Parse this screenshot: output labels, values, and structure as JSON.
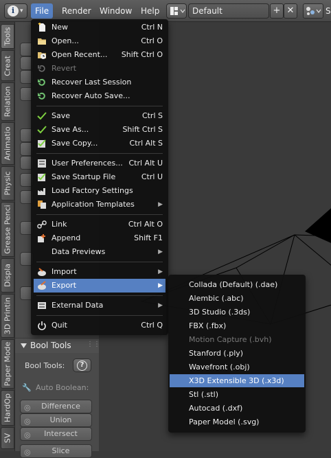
{
  "topbar": {
    "info_icon": "info-icon",
    "menus": [
      "File",
      "Render",
      "Window",
      "Help"
    ],
    "screen_layout": "Default",
    "partial_right": "S"
  },
  "tool_tabs": [
    "Tools",
    "Creat",
    "Relation",
    "Animatio",
    "Physic",
    "Grease Penci",
    "Displa",
    "3D Printin",
    "Paper Mode",
    "HardOp",
    "SV"
  ],
  "side_panel": {
    "bool_tools_header": "Bool Tools",
    "bool_tools_label": "Bool Tools:",
    "auto_boolean": "Auto Boolean:",
    "buttons": [
      "Difference",
      "Union",
      "Intersect",
      "Slice"
    ]
  },
  "file_menu": {
    "groups": [
      [
        {
          "label": "New",
          "shortcut": "Ctrl N",
          "icon": "new-file-icon"
        },
        {
          "label": "Open...",
          "shortcut": "Ctrl O",
          "icon": "folder-icon"
        },
        {
          "label": "Open Recent...",
          "shortcut": "Shift Ctrl O",
          "icon": "open-recent-icon"
        },
        {
          "label": "Revert",
          "shortcut": "",
          "icon": "revert-icon",
          "disabled": true
        },
        {
          "label": "Recover Last Session",
          "shortcut": "",
          "icon": "recover-icon"
        },
        {
          "label": "Recover Auto Save...",
          "shortcut": "",
          "icon": "recover-auto-icon"
        }
      ],
      [
        {
          "label": "Save",
          "shortcut": "Ctrl S",
          "icon": "check-icon"
        },
        {
          "label": "Save As...",
          "shortcut": "Shift Ctrl S",
          "icon": "check-icon"
        },
        {
          "label": "Save Copy...",
          "shortcut": "Ctrl Alt S",
          "icon": "save-copy-icon"
        }
      ],
      [
        {
          "label": "User Preferences...",
          "shortcut": "Ctrl Alt U",
          "icon": "preferences-icon"
        },
        {
          "label": "Save Startup File",
          "shortcut": "Ctrl U",
          "icon": "save-startup-icon"
        },
        {
          "label": "Load Factory Settings",
          "shortcut": "",
          "icon": "factory-icon"
        },
        {
          "label": "Application Templates",
          "shortcut": "",
          "icon": "templates-icon",
          "submenu": true
        }
      ],
      [
        {
          "label": "Link",
          "shortcut": "Ctrl Alt O",
          "icon": "link-icon"
        },
        {
          "label": "Append",
          "shortcut": "Shift F1",
          "icon": "append-icon"
        },
        {
          "label": "Data Previews",
          "shortcut": "",
          "icon": "",
          "submenu": true
        }
      ],
      [
        {
          "label": "Import",
          "shortcut": "",
          "icon": "import-icon",
          "submenu": true
        },
        {
          "label": "Export",
          "shortcut": "",
          "icon": "export-icon",
          "submenu": true,
          "highlighted": true
        }
      ],
      [
        {
          "label": "External Data",
          "shortcut": "",
          "icon": "external-data-icon",
          "submenu": true
        }
      ],
      [
        {
          "label": "Quit",
          "shortcut": "Ctrl Q",
          "icon": "power-icon"
        }
      ]
    ]
  },
  "export_menu": [
    {
      "label": "Collada (Default) (.dae)"
    },
    {
      "label": "Alembic (.abc)"
    },
    {
      "label": "3D Studio (.3ds)"
    },
    {
      "label": "FBX (.fbx)"
    },
    {
      "label": "Motion Capture (.bvh)",
      "disabled": true
    },
    {
      "label": "Stanford (.ply)"
    },
    {
      "label": "Wavefront (.obj)"
    },
    {
      "label": "X3D Extensible 3D (.x3d)",
      "highlighted": true
    },
    {
      "label": "Stl (.stl)"
    },
    {
      "label": "Autocad (.dxf)"
    },
    {
      "label": "Paper Model (.svg)"
    }
  ],
  "colors": {
    "highlight": "#5680c2",
    "menu_bg": "#101010"
  }
}
